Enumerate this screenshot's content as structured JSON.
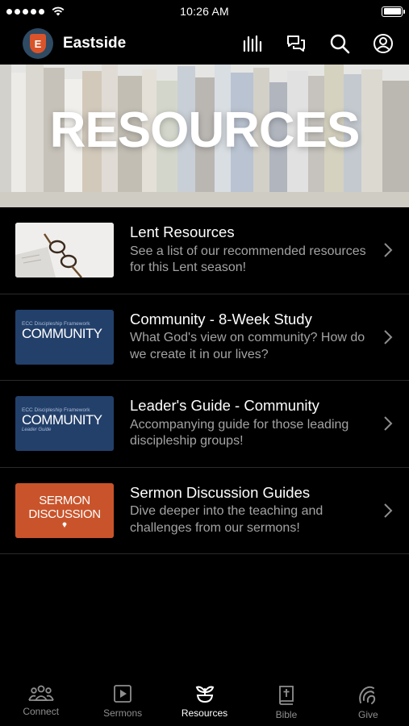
{
  "status_bar": {
    "time": "10:26 AM"
  },
  "header": {
    "app_name": "Eastside",
    "logo_letter": "E"
  },
  "hero": {
    "title": "RESOURCES"
  },
  "resources": [
    {
      "title": "Lent Resources",
      "description": "See a list of our recommended resources for this Lent season!"
    },
    {
      "title": "Community - 8-Week Study",
      "description": "What God's view on community? How do we create it in our lives?",
      "thumb_small": "ECC Discipleship Framework",
      "thumb_big": "COMMUNITY"
    },
    {
      "title": "Leader's Guide - Community",
      "description": "Accompanying guide for those leading discipleship groups!",
      "thumb_small": "ECC Discipleship Framework",
      "thumb_big": "COMMUNITY",
      "thumb_tiny": "Leader Guide"
    },
    {
      "title": "Sermon Discussion Guides",
      "description": "Dive deeper into the teaching and challenges from our sermons!",
      "thumb_line1": "SERMON",
      "thumb_line2": "DISCUSSION"
    }
  ],
  "tabs": [
    {
      "label": "Connect",
      "icon": "people-icon"
    },
    {
      "label": "Sermons",
      "icon": "play-icon"
    },
    {
      "label": "Resources",
      "icon": "sprout-icon",
      "active": true
    },
    {
      "label": "Bible",
      "icon": "bible-icon"
    },
    {
      "label": "Give",
      "icon": "give-icon"
    }
  ],
  "colors": {
    "background": "#000000",
    "accent": "#d9542a",
    "thumb_blue": "#23406b",
    "thumb_orange": "#c9542b"
  }
}
